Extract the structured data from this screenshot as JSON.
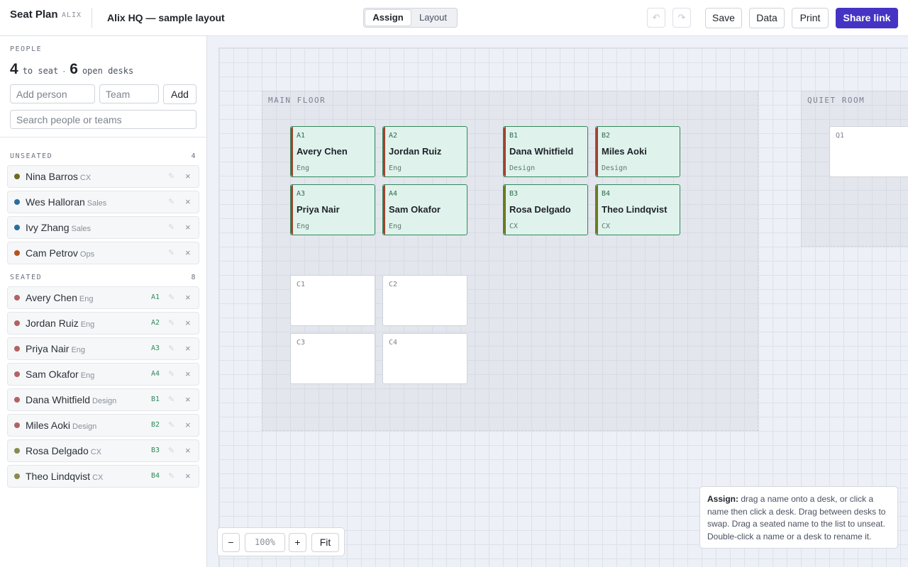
{
  "header": {
    "app_name": "Seat Plan",
    "app_sub": "ALIX",
    "doc_title": "Alix HQ — sample layout",
    "modes": [
      "Assign",
      "Layout"
    ],
    "active_mode": "Assign",
    "undo_icon": "undo-icon",
    "redo_icon": "redo-icon",
    "undo_glyph": "↶",
    "redo_glyph": "↷",
    "save_label": "Save",
    "data_label": "Data",
    "print_label": "Print",
    "share_label": "Share link",
    "accent_color": "#4534c4"
  },
  "sidebar": {
    "people_heading": "PEOPLE",
    "to_seat_count": "4",
    "to_seat_text": "to seat",
    "separator": "·",
    "open_count": "6",
    "open_text": "open desks",
    "add_person_placeholder": "Add person",
    "team_placeholder": "Team",
    "add_label": "Add",
    "search_placeholder": "Search people or teams",
    "unseated_heading": "UNSEATED",
    "unseated_count": "4",
    "seated_heading": "SEATED",
    "seated_count": "8",
    "edit_glyph": "✎",
    "remove_glyph": "×",
    "unseated": [
      {
        "name": "Nina Barros",
        "team": "CX",
        "color": "#6e6a22"
      },
      {
        "name": "Wes Halloran",
        "team": "Sales",
        "color": "#2a6e9e"
      },
      {
        "name": "Ivy Zhang",
        "team": "Sales",
        "color": "#2a6e9e"
      },
      {
        "name": "Cam Petrov",
        "team": "Ops",
        "color": "#b5521e"
      }
    ],
    "seated": [
      {
        "name": "Avery Chen",
        "team": "Eng",
        "desk": "A1",
        "color": "#b36263"
      },
      {
        "name": "Jordan Ruiz",
        "team": "Eng",
        "desk": "A2",
        "color": "#b36263"
      },
      {
        "name": "Priya Nair",
        "team": "Eng",
        "desk": "A3",
        "color": "#b36263"
      },
      {
        "name": "Sam Okafor",
        "team": "Eng",
        "desk": "A4",
        "color": "#b36263"
      },
      {
        "name": "Dana Whitfield",
        "team": "Design",
        "desk": "B1",
        "color": "#b36263"
      },
      {
        "name": "Miles Aoki",
        "team": "Design",
        "desk": "B2",
        "color": "#b36263"
      },
      {
        "name": "Rosa Delgado",
        "team": "CX",
        "desk": "B3",
        "color": "#8a8a4e"
      },
      {
        "name": "Theo Lindqvist",
        "team": "CX",
        "desk": "B4",
        "color": "#8a8a4e"
      }
    ]
  },
  "canvas": {
    "zones": [
      {
        "label": "MAIN FLOOR"
      },
      {
        "label": "QUIET ROOM"
      }
    ],
    "desks": [
      {
        "label": "A1",
        "name": "Avery Chen",
        "team": "Eng",
        "stripe": "#a0432f"
      },
      {
        "label": "A2",
        "name": "Jordan Ruiz",
        "team": "Eng",
        "stripe": "#a0432f"
      },
      {
        "label": "A3",
        "name": "Priya Nair",
        "team": "Eng",
        "stripe": "#a0432f"
      },
      {
        "label": "A4",
        "name": "Sam Okafor",
        "team": "Eng",
        "stripe": "#a0432f"
      },
      {
        "label": "B1",
        "name": "Dana Whitfield",
        "team": "Design",
        "stripe": "#a0432f"
      },
      {
        "label": "B2",
        "name": "Miles Aoki",
        "team": "Design",
        "stripe": "#a0432f"
      },
      {
        "label": "B3",
        "name": "Rosa Delgado",
        "team": "CX",
        "stripe": "#6e7a22"
      },
      {
        "label": "B4",
        "name": "Theo Lindqvist",
        "team": "CX",
        "stripe": "#6e7a22"
      },
      {
        "label": "C1"
      },
      {
        "label": "C2"
      },
      {
        "label": "C3"
      },
      {
        "label": "C4"
      },
      {
        "label": "Q1"
      }
    ],
    "help_title": "Assign:",
    "help_text": "drag a name onto a desk, or click a name then click a desk. Drag between desks to swap. Drag a seated name to the list to unseat. Double-click a name or a desk to rename it.",
    "zoom_out": "−",
    "zoom_level": "100%",
    "zoom_in": "+",
    "fit_label": "Fit"
  }
}
